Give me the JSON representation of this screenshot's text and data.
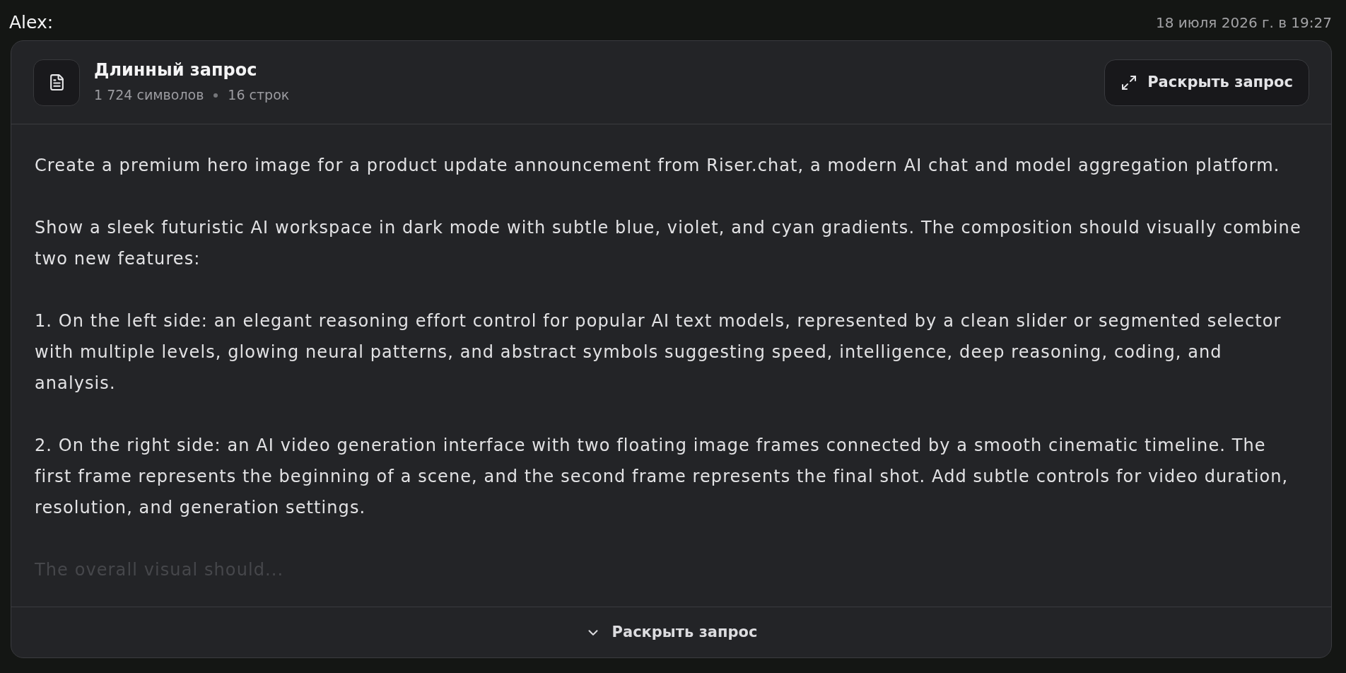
{
  "message": {
    "author": "Alex:",
    "timestamp": "18 июля 2026 г. в 19:27"
  },
  "prompt_card": {
    "title": "Длинный запрос",
    "stats": [
      "1 724 символов",
      "16 строк"
    ],
    "expand_button": "Раскрыть запрос",
    "paragraphs": [
      {
        "text": "Create a premium hero image for a product update announcement from Riser.chat, a modern AI chat and model aggregation platform.",
        "faded": false
      },
      {
        "text": "Show a sleek futuristic AI workspace in dark mode with subtle blue, violet, and cyan gradients. The composition should visually combine two new features:",
        "faded": false
      },
      {
        "text": "1. On the left side: an elegant reasoning effort control for popular AI text models, represented by a clean slider or segmented selector with multiple levels, glowing neural patterns, and abstract symbols suggesting speed, intelligence, deep reasoning, coding, and analysis.",
        "faded": false
      },
      {
        "text": "2. On the right side: an AI video generation interface with two floating image frames connected by a smooth cinematic timeline. The first frame represents the beginning of a scene, and the second frame represents the final shot. Add subtle controls for video duration, resolution, and generation settings.",
        "faded": false
      },
      {
        "text": "The overall visual should...",
        "faded": true
      }
    ],
    "footer_button": "Раскрыть запрос",
    "expanded": false
  }
}
